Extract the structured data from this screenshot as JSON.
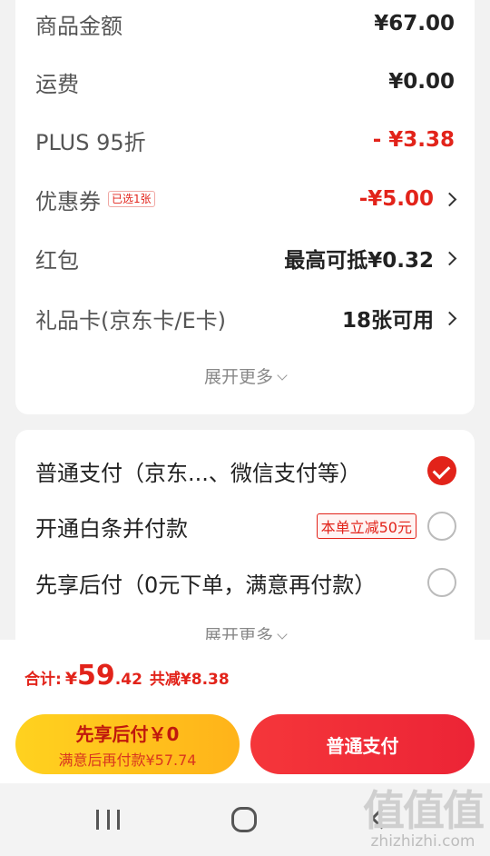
{
  "fees": {
    "rows": [
      {
        "label": "商品金额",
        "value": "¥67.00"
      },
      {
        "label": "运费",
        "value": "¥0.00"
      },
      {
        "label": "PLUS 95折",
        "value": "- ¥3.38"
      },
      {
        "label": "优惠券",
        "tag": "已选1张",
        "value": "-¥5.00"
      },
      {
        "label": "红包",
        "value": "最高可抵¥0.32"
      },
      {
        "label": "礼品卡(京东卡/E卡)",
        "value": "18张可用"
      }
    ],
    "expand_label": "展开更多"
  },
  "payment": {
    "options": [
      {
        "label": "普通支付（京东...、微信支付等）",
        "selected": true
      },
      {
        "label": "开通白条并付款",
        "promo": "本单立减50元",
        "selected": false
      },
      {
        "label": "先享后付（0元下单，满意再付款）",
        "selected": false
      }
    ],
    "expand_label": "展开更多"
  },
  "summary": {
    "total_label": "合计:",
    "currency": "¥",
    "total_int": "59",
    "total_dec": ".42",
    "savings": "共减¥8.38"
  },
  "buttons": {
    "later_line1": "先享后付￥0",
    "later_line2": "满意后再付款¥57.74",
    "normal": "普通支付"
  },
  "watermark": {
    "logo": "值值值",
    "url": "zhizhizhi.com"
  },
  "colors": {
    "accent_red": "#e2231a",
    "later_button": "#ffc21d",
    "background": "#f2f2f2"
  }
}
